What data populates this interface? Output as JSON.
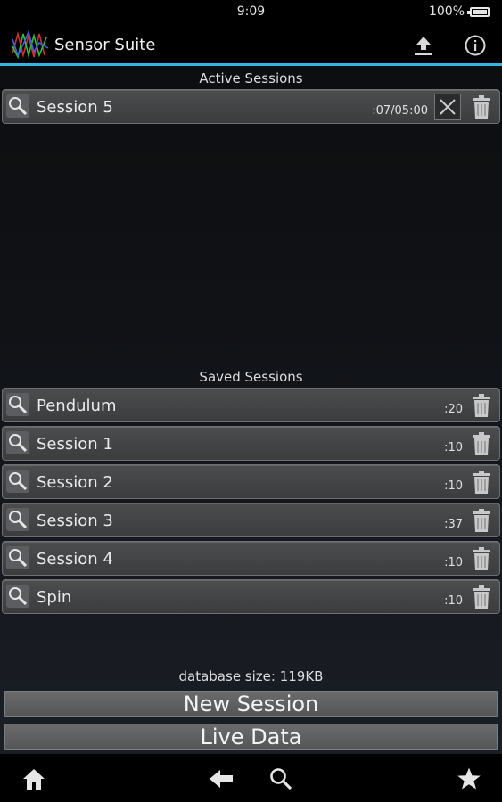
{
  "status_bar": {
    "time": "9:09",
    "battery": "100%"
  },
  "action_bar": {
    "title": "Sensor Suite",
    "icons": {
      "upload": "upload-icon",
      "info": "info-icon",
      "logo": "waveform-logo"
    }
  },
  "active_section": {
    "header": "Active Sessions",
    "items": [
      {
        "label": "Session 5",
        "time": ":07/05:00"
      }
    ]
  },
  "saved_section": {
    "header": "Saved Sessions",
    "items": [
      {
        "label": "Pendulum",
        "time": ":20"
      },
      {
        "label": "Session 1",
        "time": ":10"
      },
      {
        "label": "Session 2",
        "time": ":10"
      },
      {
        "label": "Session 3",
        "time": ":37"
      },
      {
        "label": "Session 4",
        "time": ":10"
      },
      {
        "label": "Spin",
        "time": ":10"
      }
    ]
  },
  "footer": {
    "db_size": "database size: 119KB",
    "new_session": "New Session",
    "live_data": "Live Data"
  },
  "nav_icons": [
    "home-icon",
    "back-icon",
    "search-icon",
    "star-icon"
  ],
  "colors": {
    "accent": "#33b5e5",
    "bar_bg": "#000000"
  }
}
